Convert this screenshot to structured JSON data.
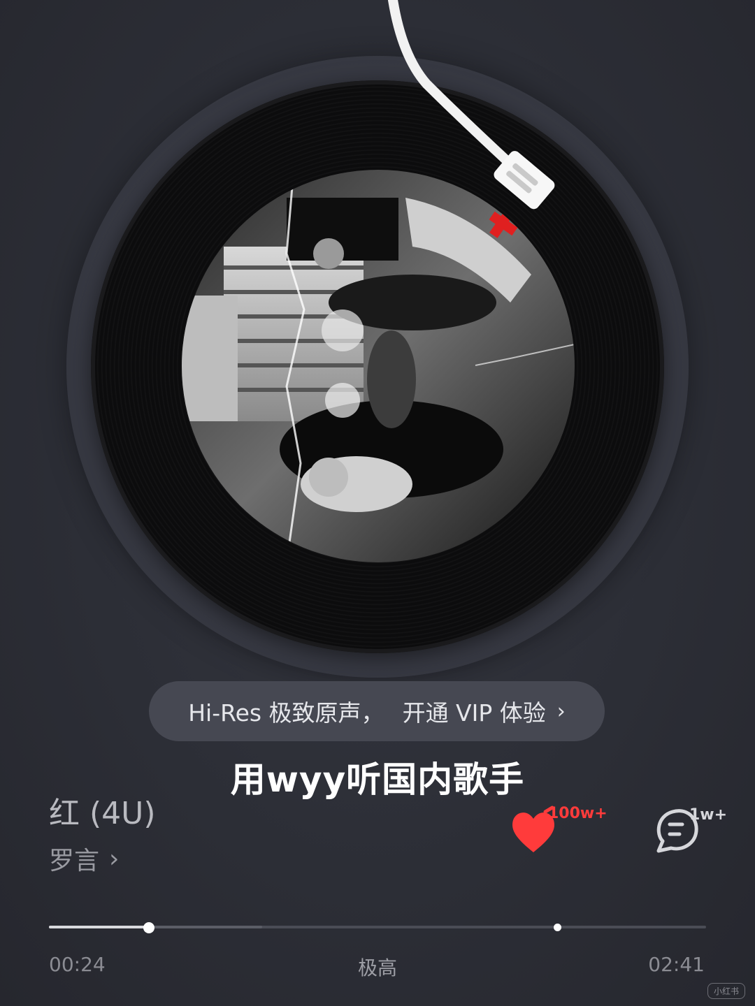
{
  "banner": {
    "text_left": "Hi-Res 极致原声，",
    "text_right": "开通 VIP 体验",
    "chevron": "›"
  },
  "caption": "用wyy听国内歌手",
  "song": {
    "title": "红 (4U)",
    "artist": "罗言",
    "artist_chevron": "›"
  },
  "actions": {
    "like_count": "100w+",
    "comment_count": "1w+"
  },
  "playback": {
    "current_time": "00:24",
    "total_time": "02:41",
    "quality": "极高",
    "progress_fraction": 0.152,
    "buffered_fraction": 0.324,
    "marker_fraction": 0.773
  },
  "watermark": "小红书",
  "colors": {
    "accent_red": "#ff3b3b",
    "background": "#2b2d35",
    "banner_bg": "#464852"
  },
  "icons": {
    "like": "heart-icon",
    "comment": "comment-bubble-icon",
    "artist_more": "chevron-right-icon",
    "banner_more": "chevron-right-icon"
  }
}
